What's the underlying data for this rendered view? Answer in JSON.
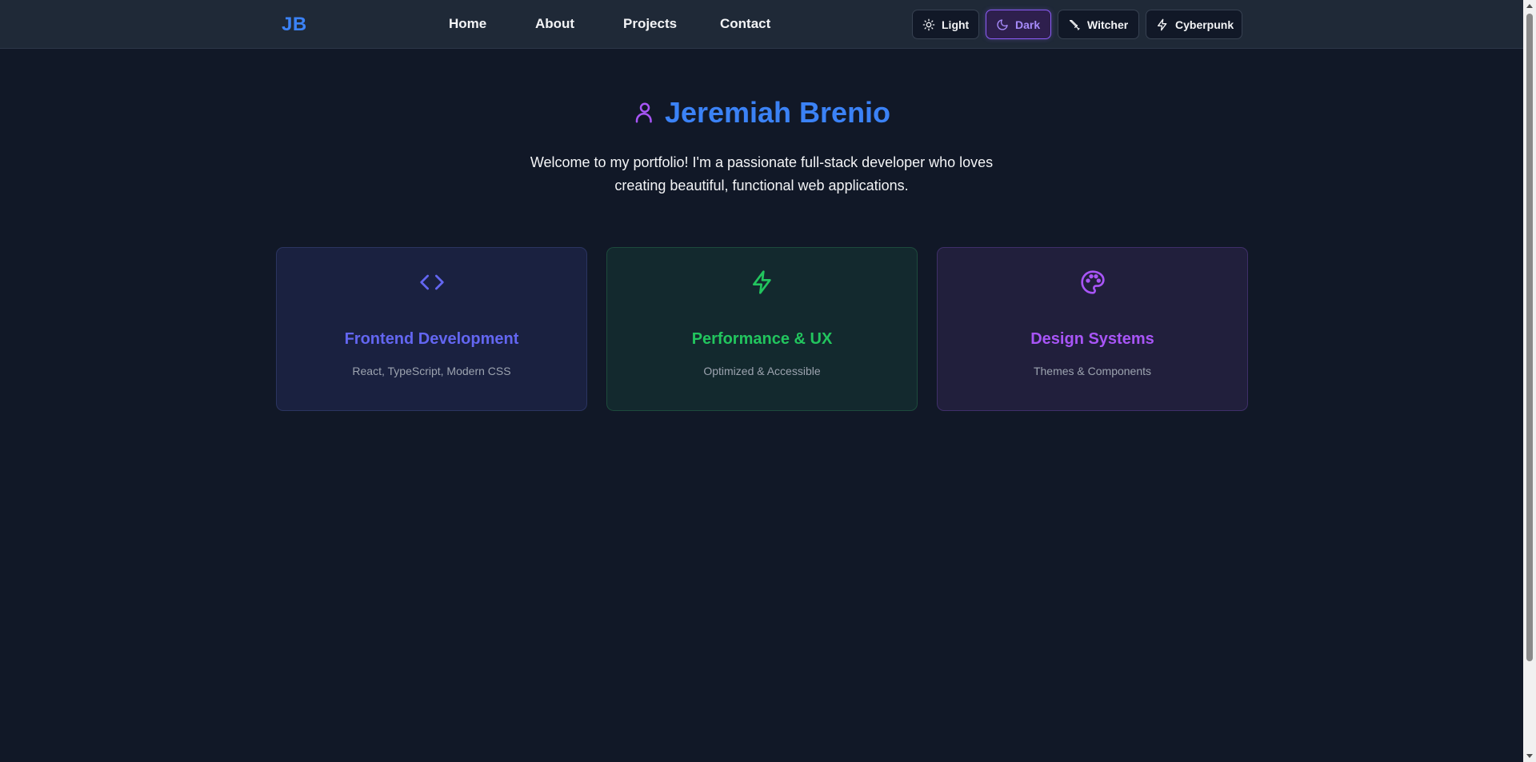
{
  "navbar": {
    "logo": "JB",
    "links": [
      {
        "label": "Home"
      },
      {
        "label": "About"
      },
      {
        "label": "Projects"
      },
      {
        "label": "Contact"
      }
    ],
    "themes": [
      {
        "label": "Light",
        "icon": "sun-icon",
        "active": false
      },
      {
        "label": "Dark",
        "icon": "moon-icon",
        "active": true
      },
      {
        "label": "Witcher",
        "icon": "sword-icon",
        "active": false
      },
      {
        "label": "Cyberpunk",
        "icon": "lightning-icon",
        "active": false
      }
    ]
  },
  "hero": {
    "icon": "user-icon",
    "name": "Jeremiah Brenio",
    "description": "Welcome to my portfolio! I'm a passionate full-stack developer who loves creating beautiful, functional web applications."
  },
  "cards": [
    {
      "icon": "code-icon",
      "title": "Frontend Development",
      "subtitle": "React, TypeScript, Modern CSS",
      "color": "#6366f1"
    },
    {
      "icon": "lightning-icon",
      "title": "Performance & UX",
      "subtitle": "Optimized & Accessible",
      "color": "#22c55e"
    },
    {
      "icon": "palette-icon",
      "title": "Design Systems",
      "subtitle": "Themes & Components",
      "color": "#a855f7"
    }
  ],
  "colors": {
    "background": "#111827",
    "navbar": "#1f2937",
    "accent": "#3b82f6",
    "active_theme": "#8b5cf6"
  }
}
